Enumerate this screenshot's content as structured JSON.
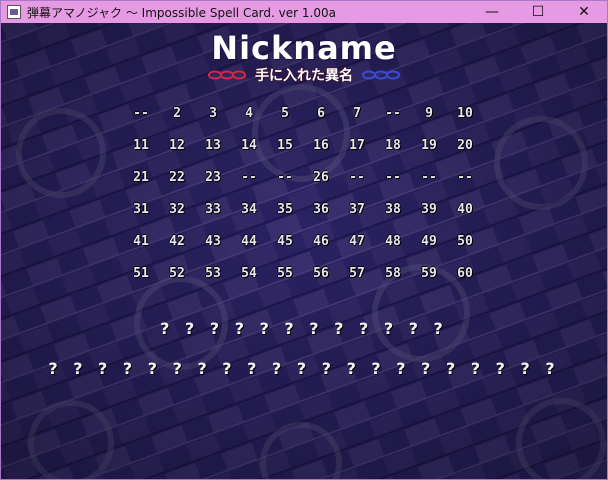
{
  "window": {
    "title": "弾幕アマノジャク 〜 Impossible Spell Card. ver 1.00a",
    "minimize": "—",
    "maximize": "☐",
    "close": "✕"
  },
  "screen": {
    "title": "Nickname",
    "subtitle": "手に入れた異名"
  },
  "nicknames": {
    "rows": [
      [
        "--",
        "2",
        "3",
        "4",
        "5",
        "6",
        "7",
        "--",
        "9",
        "10"
      ],
      [
        "11",
        "12",
        "13",
        "14",
        "15",
        "16",
        "17",
        "18",
        "19",
        "20"
      ],
      [
        "21",
        "22",
        "23",
        "--",
        "--",
        "26",
        "--",
        "--",
        "--",
        "--"
      ],
      [
        "31",
        "32",
        "33",
        "34",
        "35",
        "36",
        "37",
        "38",
        "39",
        "40"
      ],
      [
        "41",
        "42",
        "43",
        "44",
        "45",
        "46",
        "47",
        "48",
        "49",
        "50"
      ],
      [
        "51",
        "52",
        "53",
        "54",
        "55",
        "56",
        "57",
        "58",
        "59",
        "60"
      ]
    ]
  },
  "selected": {
    "name": "? ? ? ? ? ? ? ? ? ? ? ?",
    "description": "? ? ? ? ? ? ? ? ? ? ? ? ? ? ? ? ? ? ? ? ?"
  },
  "colors": {
    "titlebar": "#e79ae4",
    "background": "#2a2260",
    "text": "#e6e6ee"
  }
}
